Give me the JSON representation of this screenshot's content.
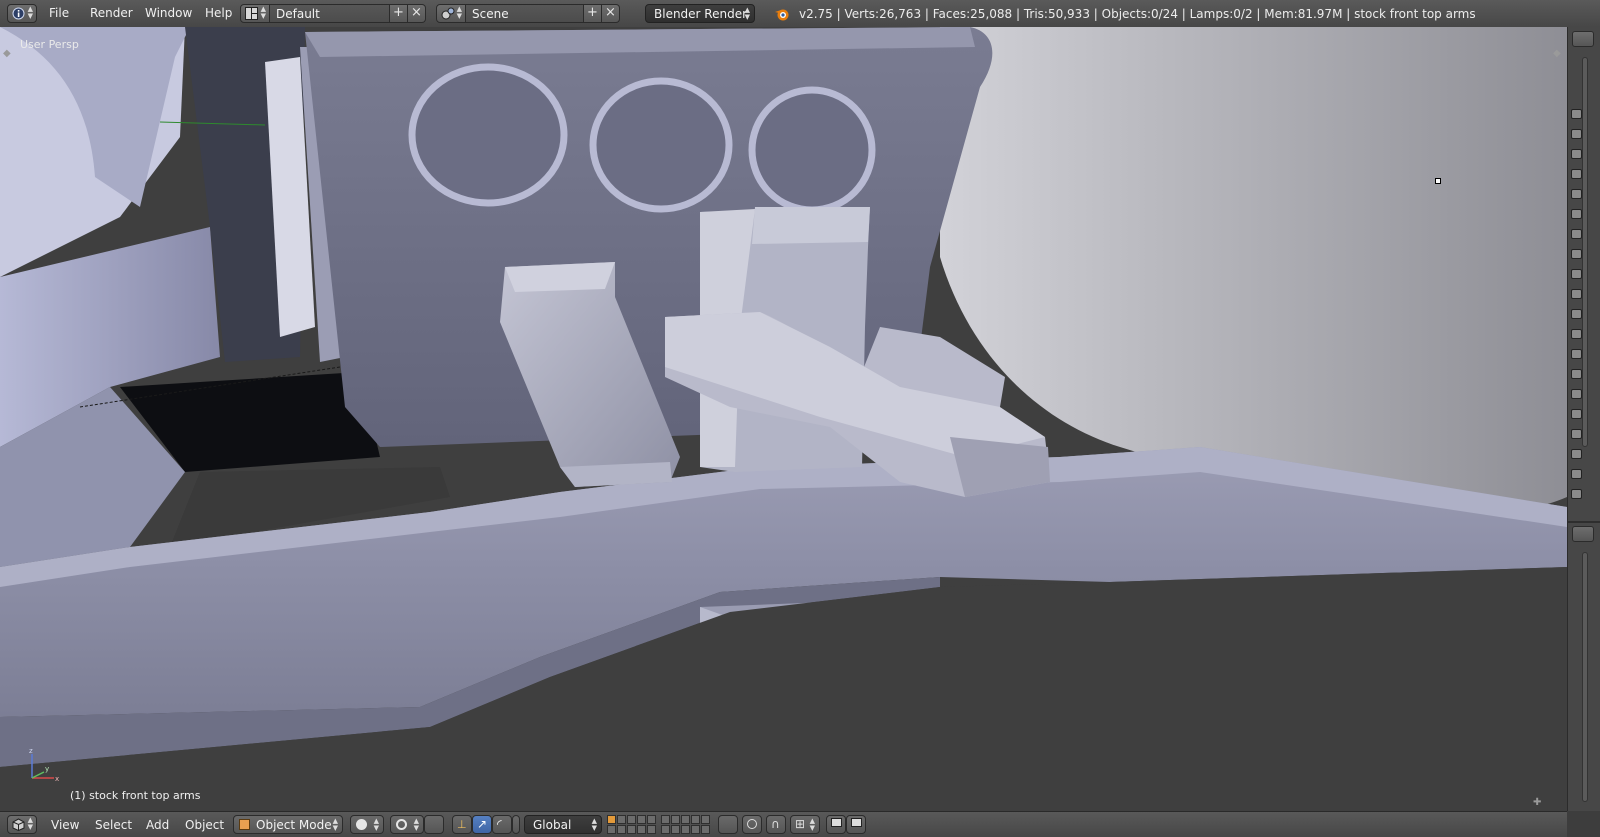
{
  "header": {
    "menus": [
      "File",
      "Render",
      "Window",
      "Help"
    ],
    "layout": {
      "value": "Default",
      "add": "+",
      "remove": "×"
    },
    "scene": {
      "value": "Scene",
      "add": "+",
      "remove": "×"
    },
    "render_engine": "Blender Render",
    "stats": "v2.75 | Verts:26,763 | Faces:25,088 | Tris:50,933 | Objects:0/24 | Lamps:0/2 | Mem:81.97M | stock front top arms"
  },
  "viewport": {
    "view_label": "User Persp",
    "object_label": "(1) stock front top arms",
    "axes": {
      "x": "x",
      "y": "y",
      "z": "z"
    },
    "colors": {
      "background": "#3f3f3f",
      "mesh": "#8c8fa6",
      "mesh_light": "#b4b7cc",
      "mesh_dark": "#62657a"
    }
  },
  "footer": {
    "menus": [
      "View",
      "Select",
      "Add",
      "Object"
    ],
    "mode": "Object Mode",
    "orientation": "Global"
  },
  "icons": {
    "editor_type": "info-icon",
    "layout": "screen-layout-icon",
    "scene": "scene-icon",
    "logo": "blender-logo-icon",
    "viewport_shading": "solid-shading-icon",
    "pivot": "pivot-point-icon",
    "manipulator": "manipulator-icon",
    "render": "render-icon",
    "camera": "camera-icon"
  }
}
